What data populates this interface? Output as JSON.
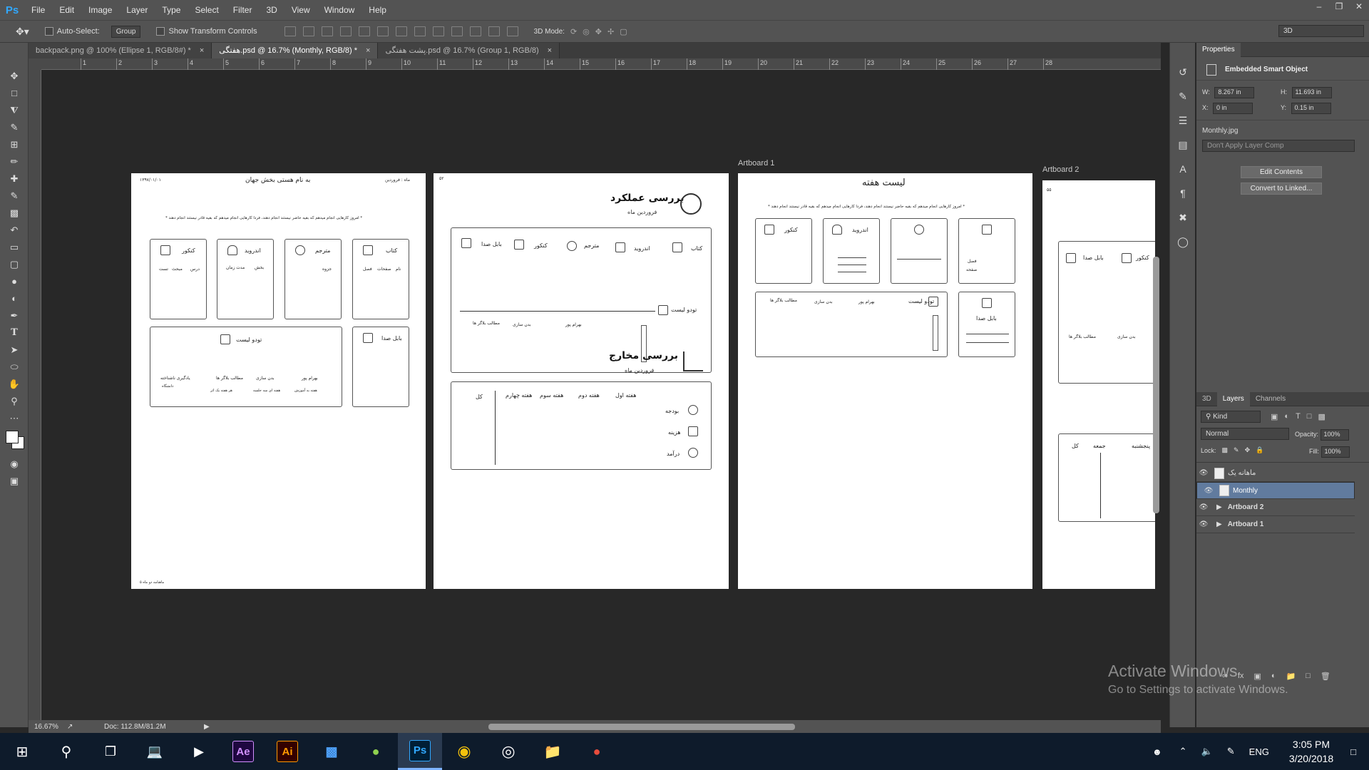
{
  "app": {
    "logo": "Ps"
  },
  "menu": [
    "File",
    "Edit",
    "Image",
    "Layer",
    "Type",
    "Select",
    "Filter",
    "3D",
    "View",
    "Window",
    "Help"
  ],
  "options": {
    "auto_select": "Auto-Select:",
    "group": "Group",
    "show_transform": "Show Transform Controls",
    "mode_3d": "3D Mode:",
    "workspace": "3D"
  },
  "tabs": [
    {
      "label": "backpack.png @ 100% (Ellipse 1, RGB/8#) *",
      "active": false
    },
    {
      "label": "هفتگی.psd @ 16.7% (Monthly, RGB/8) *",
      "active": true
    },
    {
      "label": "پشت هفتگی.psd @ 16.7% (Group 1, RGB/8)",
      "active": false
    }
  ],
  "tab_close": "×",
  "ruler_top": [
    "1",
    "2",
    "3",
    "4",
    "5",
    "6",
    "7",
    "8",
    "9",
    "10",
    "11",
    "12",
    "13",
    "14",
    "15",
    "16",
    "17",
    "18",
    "19",
    "20",
    "21",
    "22",
    "23",
    "24",
    "25",
    "26",
    "27",
    "28"
  ],
  "artboards": {
    "label1": "Artboard 1",
    "label2": "Artboard 2",
    "ab1": {
      "title": "به نام هستی بخش جهان",
      "date_right": "ماه : فروردین",
      "date_left": "۱۳۹۷/۰۱/۰۱",
      "intro": "* امروز کارهایی انجام میدهم که بقیه حاضر نیستند انجام دهند، فردا کارهایی انجام میدهم که بقیه قادر نیستند انجام دهند *",
      "cards": [
        {
          "title": "کتاب",
          "lines": [
            "نام",
            "صفحات",
            "فصل"
          ]
        },
        {
          "title": "مترجم",
          "lines": [
            "جزوه"
          ]
        },
        {
          "title": "اندروید",
          "lines": [
            "بخش",
            "مدت زمان"
          ]
        },
        {
          "title": "کنکور",
          "lines": [
            "درس",
            "مبحث",
            "تست"
          ]
        }
      ],
      "podcast": "بابل صدا",
      "todo": "تودو لیست",
      "todo_items": [
        "بهرام پور",
        "بدن سازی",
        "مطالب بلاگر ها",
        "یادگیری ناشناخته"
      ],
      "todo_subs": [
        "هفته به آموزش",
        "هفته ای سه جلسه",
        "هر هفته یک اثر",
        "دانشگاه"
      ],
      "footer": "ماهنامه دو ماه ۵"
    },
    "ab2": {
      "page": "۵۲",
      "perf_title": "بررسی عملکرد",
      "perf_sub": "فروردین ماه",
      "perf_icons": [
        "کتاب",
        "اندروید",
        "مترجم",
        "کنکور",
        "بابل صدا"
      ],
      "todo": "تودو لیست",
      "todo_items": [
        "بهرام پور",
        "بدن سازی",
        "مطالب بلاگر ها"
      ],
      "exp_title": "بررسی مخارج",
      "exp_sub": "فروردین ماه",
      "weeks": [
        "هفته اول",
        "هفته دوم",
        "هفته سوم",
        "هفته چهارم"
      ],
      "total": "کل",
      "rows": [
        "بودجه",
        "هزینه",
        "درآمد"
      ]
    },
    "ab3": {
      "title": "لیست هفته",
      "intro": "* امروز کارهایی انجام میدهم که بقیه حاضر نیستند انجام دهند، فردا کارهایی انجام میدهم که بقیه قادر نیستند انجام دهند *",
      "card_konkur": "کنکور",
      "card_android": "اندروید",
      "card_book_lines": [
        "فصل",
        "صفحه"
      ],
      "podcast": "بابل صدا",
      "todo": "تودو لیست",
      "todo_items": [
        "بهرام پور",
        "بدن سازی",
        "مطالب بلاگر ها"
      ]
    },
    "ab4": {
      "page": "۵۵",
      "podcast": "بابل صدا",
      "konkur": "کنکور",
      "items": [
        "بدن سازی",
        "مطالب بلاگر ها"
      ],
      "days": [
        "پنجشنبه",
        "جمعه",
        "کل"
      ]
    }
  },
  "status": {
    "zoom": "16.67%",
    "doc": "Doc: 112.8M/81.2M"
  },
  "properties": {
    "tab": "Properties",
    "type": "Embedded Smart Object",
    "w_label": "W:",
    "w": "8.267 in",
    "h_label": "H:",
    "h": "11.693 in",
    "x_label": "X:",
    "x": "0 in",
    "y_label": "Y:",
    "y": "0.15 in",
    "file": "Monthly.jpg",
    "layer_comp": "Don't Apply Layer Comp",
    "edit_contents": "Edit Contents",
    "convert": "Convert to Linked..."
  },
  "layers_panel": {
    "tabs": [
      "3D",
      "Layers",
      "Channels"
    ],
    "kind": "Kind",
    "blend": "Normal",
    "opacity_label": "Opacity:",
    "opacity": "100%",
    "lock_label": "Lock:",
    "fill_label": "Fill:",
    "fill": "100%",
    "layers": [
      {
        "name": "ماهانه یک",
        "selected": false,
        "group": false
      },
      {
        "name": "Monthly",
        "selected": true,
        "group": false
      },
      {
        "name": "Artboard 2",
        "selected": false,
        "group": true
      },
      {
        "name": "Artboard 1",
        "selected": false,
        "group": true
      }
    ]
  },
  "activate": {
    "line1": "Activate Windows",
    "line2": "Go to Settings to activate Windows."
  },
  "taskbar": {
    "apps": [
      {
        "name": "ae",
        "label": "Ae",
        "bg": "#1f0740",
        "fg": "#d291ff"
      },
      {
        "name": "ai",
        "label": "Ai",
        "bg": "#330000",
        "fg": "#ff9a00"
      },
      {
        "name": "ps",
        "label": "Ps",
        "bg": "#001e36",
        "fg": "#31a8ff"
      }
    ],
    "lang": "ENG",
    "time": "3:05 PM",
    "date": "3/20/2018"
  }
}
